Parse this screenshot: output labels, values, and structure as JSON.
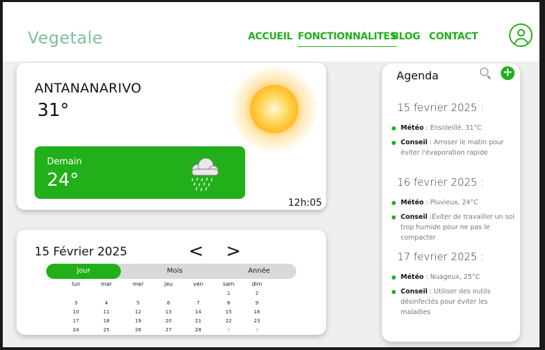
{
  "brand": {
    "logo": "Vegetale",
    "accent": "#22b01a"
  },
  "nav": {
    "items": [
      {
        "label": "ACCUEIL",
        "active": false
      },
      {
        "label": "FONCTIONNALITES",
        "active": true
      },
      {
        "label": "BLOG",
        "active": false
      },
      {
        "label": "CONTACT",
        "active": false
      }
    ],
    "profile_icon": "user-circle-icon"
  },
  "weather": {
    "city": "ANTANANARIVO",
    "temperature": "31°",
    "condition_icon": "sun-icon",
    "tomorrow": {
      "label": "Demain",
      "temperature": "24°",
      "icon": "rain-cloud-icon"
    },
    "time": "12h:05"
  },
  "calendar": {
    "date": "15 Février 2025",
    "prev": "<",
    "next": ">",
    "views": [
      {
        "label": "Jour",
        "selected": true
      },
      {
        "label": "Mois",
        "selected": false
      },
      {
        "label": "Année",
        "selected": false
      }
    ],
    "weekdays": [
      "lun",
      "mar",
      "mer",
      "jeu",
      "ven",
      "sam",
      "dim"
    ],
    "weeks": [
      [
        "",
        "",
        "",
        "",
        "",
        "1",
        "2"
      ],
      [
        "3",
        "4",
        "5",
        "6",
        "7",
        "8",
        "9"
      ],
      [
        "10",
        "11",
        "12",
        "13",
        "14",
        "15",
        "16"
      ],
      [
        "17",
        "18",
        "19",
        "20",
        "21",
        "22",
        "23"
      ],
      [
        "24",
        "25",
        "26",
        "27",
        "28",
        "1",
        "2"
      ]
    ],
    "next_month_days_in_last_week": 2
  },
  "agenda": {
    "title": "Agenda",
    "search_icon": "search-icon",
    "add_icon": "plus-icon",
    "days": [
      {
        "date": "15 fevrier 2025 :",
        "meteo_label": "Météo",
        "meteo": " : Ensoleillé, 31°C",
        "conseil_label": "Conseil",
        "conseil": " : Arroser le matin pour éviter l'évaporation rapide"
      },
      {
        "date": "16 fevrier 2025 :",
        "meteo_label": "Météo",
        "meteo": " : Pluvieux, 24°C",
        "conseil_label": "Conseil",
        "conseil": " :Éviter de travailler un sol trop humide pour ne pas le compacter"
      },
      {
        "date": "17 fevrier 2025 :",
        "meteo_label": "Météo",
        "meteo": " : Nuageux, 25°C",
        "conseil_label": "Conseil",
        "conseil": " : Utiliser des outils désinfectés pour éviter les maladies"
      }
    ]
  }
}
